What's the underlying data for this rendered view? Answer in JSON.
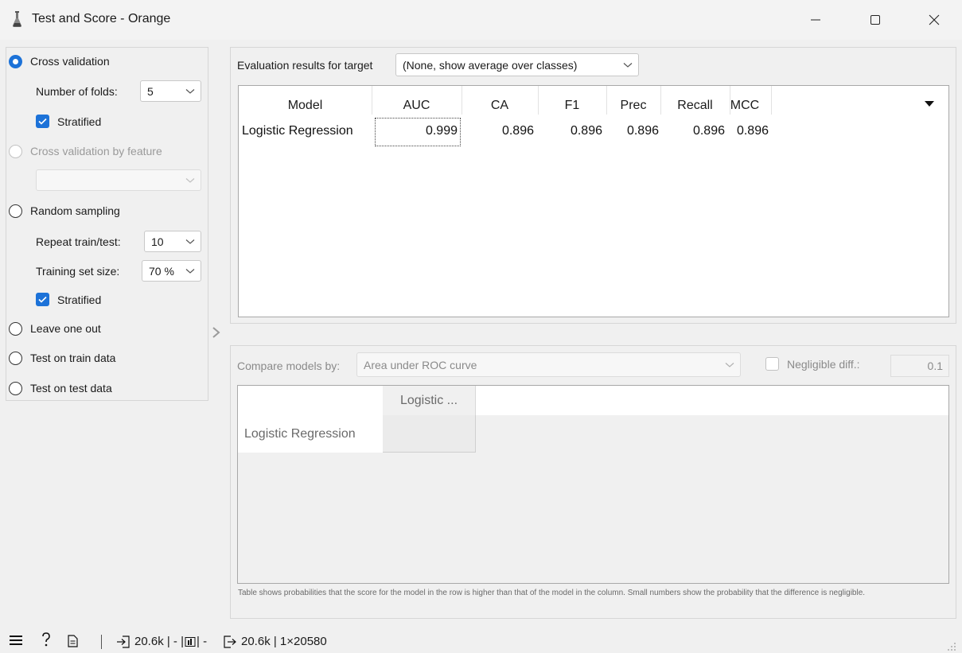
{
  "window": {
    "title": "Test and Score - Orange"
  },
  "sampling": {
    "cross_validation": {
      "label": "Cross validation",
      "checked": true
    },
    "folds": {
      "label": "Number of folds:",
      "value": "5"
    },
    "stratified_1": {
      "label": "Stratified",
      "checked": true
    },
    "cv_by_feature": {
      "label": "Cross validation by feature",
      "enabled": false,
      "value": ""
    },
    "random_sampling": {
      "label": "Random sampling"
    },
    "repeat": {
      "label": "Repeat train/test:",
      "value": "10"
    },
    "train_size": {
      "label": "Training set size:",
      "value": "70 %"
    },
    "stratified_2": {
      "label": "Stratified",
      "checked": true
    },
    "leave_one_out": {
      "label": "Leave one out"
    },
    "test_on_train": {
      "label": "Test on train data"
    },
    "test_on_test": {
      "label": "Test on test data"
    }
  },
  "evaluation": {
    "target_label": "Evaluation results for target",
    "target_value": "(None, show average over classes)",
    "columns": [
      "Model",
      "AUC",
      "CA",
      "F1",
      "Prec",
      "Recall",
      "MCC"
    ],
    "rows": [
      {
        "model": "Logistic Regression",
        "auc": "0.999",
        "ca": "0.896",
        "f1": "0.896",
        "prec": "0.896",
        "recall": "0.896",
        "mcc": "0.896"
      }
    ]
  },
  "comparison": {
    "label": "Compare models by:",
    "value": "Area under ROC curve",
    "negligible_label": "Negligible diff.:",
    "negligible_value": "0.1",
    "column_header": "Logistic ...",
    "row_header": "Logistic Regression",
    "footnote": "Table shows probabilities that the score for the model in the row is higher than that of the model in the column. Small numbers show the probability that the difference is negligible."
  },
  "statusbar": {
    "input_summary": "20.6k | - | ",
    "input_suffix": " | -",
    "output_summary": "20.6k | 1×20580"
  },
  "colors": {
    "accent": "#1c72d8",
    "background": "#f0f0f0"
  }
}
